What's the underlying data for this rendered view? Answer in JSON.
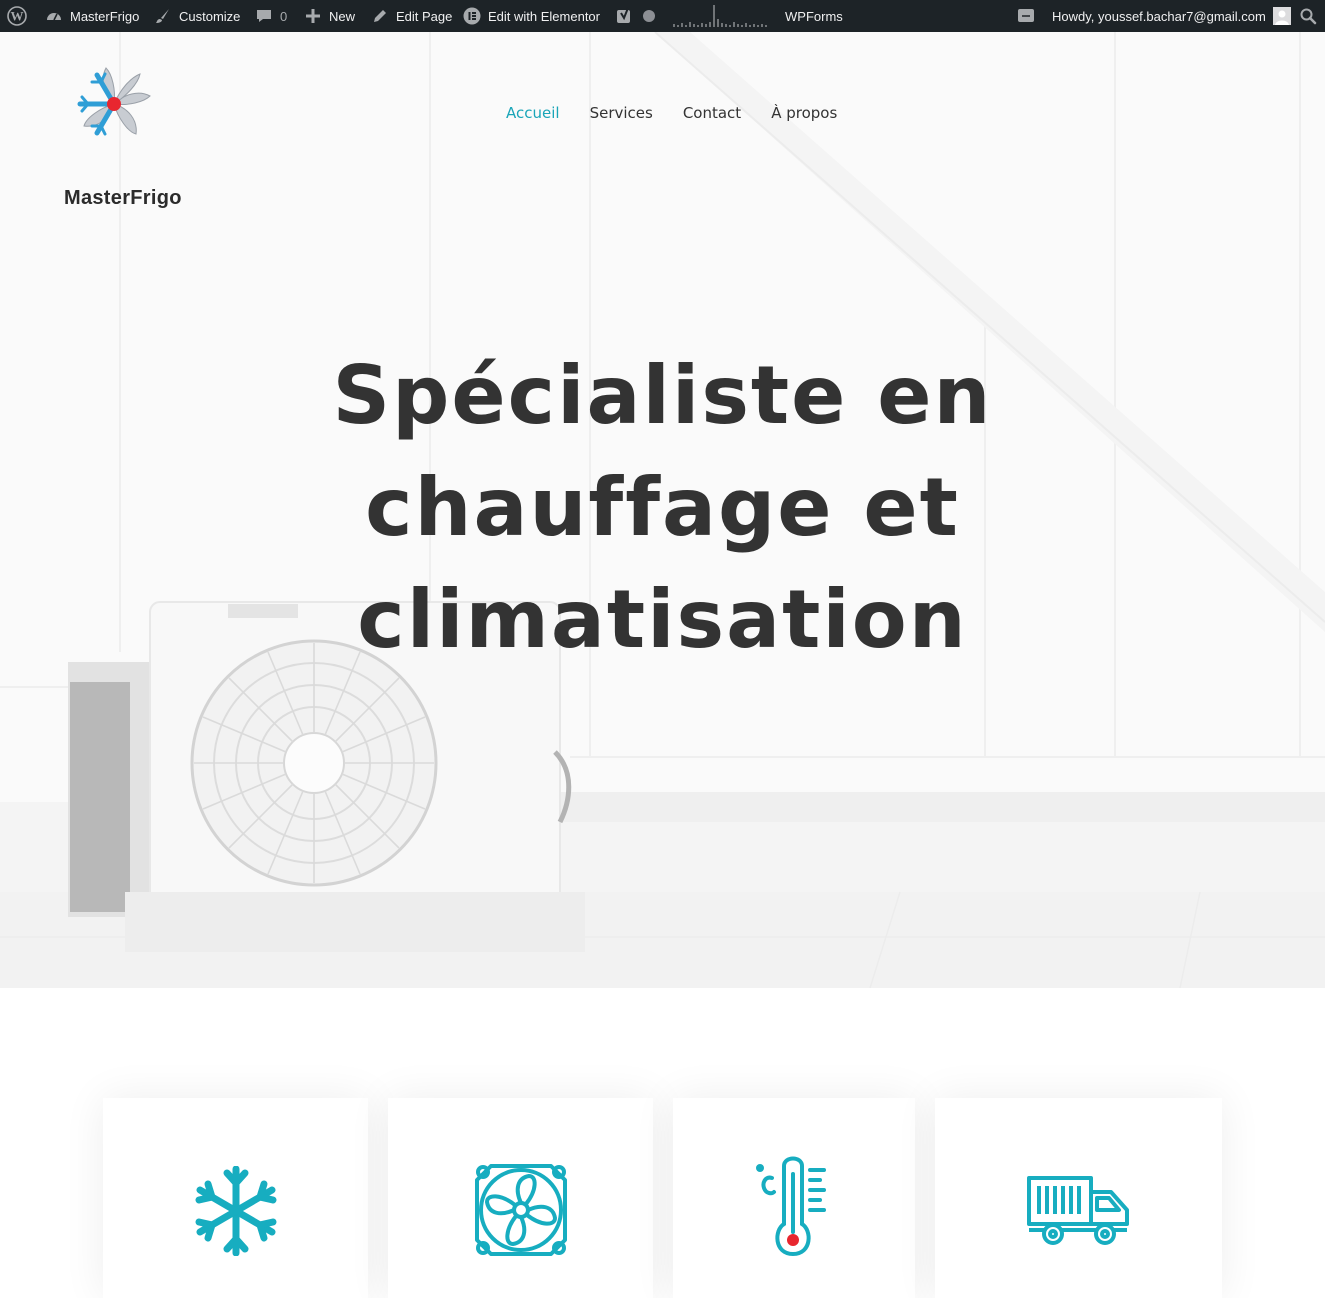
{
  "admin_bar": {
    "site_name": "MasterFrigo",
    "customize": "Customize",
    "comments_count": "0",
    "new": "New",
    "edit_page": "Edit Page",
    "edit_elementor": "Edit with Elementor",
    "wpforms": "WPForms",
    "howdy": "Howdy, youssef.bachar7@gmail.com"
  },
  "brand": {
    "name": "MasterFrigo"
  },
  "nav": {
    "items": [
      {
        "label": "Accueil",
        "active": true
      },
      {
        "label": "Services"
      },
      {
        "label": "Contact"
      },
      {
        "label": "À propos"
      }
    ]
  },
  "hero": {
    "title": "Spécialiste en chauffage et climatisation"
  },
  "services": {
    "cards": [
      {
        "icon": "snowflake-icon"
      },
      {
        "icon": "fan-icon"
      },
      {
        "icon": "thermometer-icon"
      },
      {
        "icon": "delivery-truck-icon"
      }
    ]
  },
  "colors": {
    "accent": "#1aa5b8",
    "admin_bar": "#1d2327",
    "heading": "#333333",
    "thermo_red": "#e8262f"
  }
}
